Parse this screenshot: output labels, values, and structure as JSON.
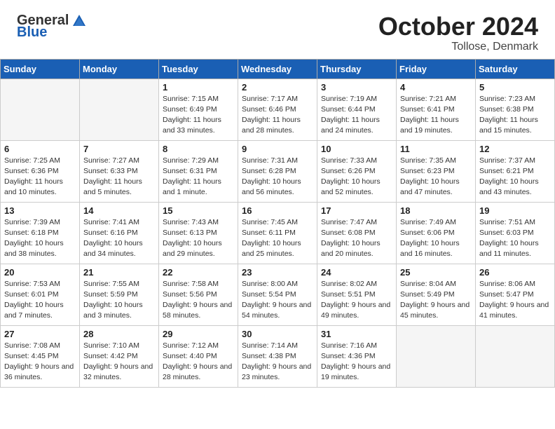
{
  "header": {
    "logo_general": "General",
    "logo_blue": "Blue",
    "title": "October 2024",
    "location": "Tollose, Denmark"
  },
  "days_of_week": [
    "Sunday",
    "Monday",
    "Tuesday",
    "Wednesday",
    "Thursday",
    "Friday",
    "Saturday"
  ],
  "weeks": [
    [
      {
        "day": "",
        "info": ""
      },
      {
        "day": "",
        "info": ""
      },
      {
        "day": "1",
        "info": "Sunrise: 7:15 AM\nSunset: 6:49 PM\nDaylight: 11 hours and 33 minutes."
      },
      {
        "day": "2",
        "info": "Sunrise: 7:17 AM\nSunset: 6:46 PM\nDaylight: 11 hours and 28 minutes."
      },
      {
        "day": "3",
        "info": "Sunrise: 7:19 AM\nSunset: 6:44 PM\nDaylight: 11 hours and 24 minutes."
      },
      {
        "day": "4",
        "info": "Sunrise: 7:21 AM\nSunset: 6:41 PM\nDaylight: 11 hours and 19 minutes."
      },
      {
        "day": "5",
        "info": "Sunrise: 7:23 AM\nSunset: 6:38 PM\nDaylight: 11 hours and 15 minutes."
      }
    ],
    [
      {
        "day": "6",
        "info": "Sunrise: 7:25 AM\nSunset: 6:36 PM\nDaylight: 11 hours and 10 minutes."
      },
      {
        "day": "7",
        "info": "Sunrise: 7:27 AM\nSunset: 6:33 PM\nDaylight: 11 hours and 5 minutes."
      },
      {
        "day": "8",
        "info": "Sunrise: 7:29 AM\nSunset: 6:31 PM\nDaylight: 11 hours and 1 minute."
      },
      {
        "day": "9",
        "info": "Sunrise: 7:31 AM\nSunset: 6:28 PM\nDaylight: 10 hours and 56 minutes."
      },
      {
        "day": "10",
        "info": "Sunrise: 7:33 AM\nSunset: 6:26 PM\nDaylight: 10 hours and 52 minutes."
      },
      {
        "day": "11",
        "info": "Sunrise: 7:35 AM\nSunset: 6:23 PM\nDaylight: 10 hours and 47 minutes."
      },
      {
        "day": "12",
        "info": "Sunrise: 7:37 AM\nSunset: 6:21 PM\nDaylight: 10 hours and 43 minutes."
      }
    ],
    [
      {
        "day": "13",
        "info": "Sunrise: 7:39 AM\nSunset: 6:18 PM\nDaylight: 10 hours and 38 minutes."
      },
      {
        "day": "14",
        "info": "Sunrise: 7:41 AM\nSunset: 6:16 PM\nDaylight: 10 hours and 34 minutes."
      },
      {
        "day": "15",
        "info": "Sunrise: 7:43 AM\nSunset: 6:13 PM\nDaylight: 10 hours and 29 minutes."
      },
      {
        "day": "16",
        "info": "Sunrise: 7:45 AM\nSunset: 6:11 PM\nDaylight: 10 hours and 25 minutes."
      },
      {
        "day": "17",
        "info": "Sunrise: 7:47 AM\nSunset: 6:08 PM\nDaylight: 10 hours and 20 minutes."
      },
      {
        "day": "18",
        "info": "Sunrise: 7:49 AM\nSunset: 6:06 PM\nDaylight: 10 hours and 16 minutes."
      },
      {
        "day": "19",
        "info": "Sunrise: 7:51 AM\nSunset: 6:03 PM\nDaylight: 10 hours and 11 minutes."
      }
    ],
    [
      {
        "day": "20",
        "info": "Sunrise: 7:53 AM\nSunset: 6:01 PM\nDaylight: 10 hours and 7 minutes."
      },
      {
        "day": "21",
        "info": "Sunrise: 7:55 AM\nSunset: 5:59 PM\nDaylight: 10 hours and 3 minutes."
      },
      {
        "day": "22",
        "info": "Sunrise: 7:58 AM\nSunset: 5:56 PM\nDaylight: 9 hours and 58 minutes."
      },
      {
        "day": "23",
        "info": "Sunrise: 8:00 AM\nSunset: 5:54 PM\nDaylight: 9 hours and 54 minutes."
      },
      {
        "day": "24",
        "info": "Sunrise: 8:02 AM\nSunset: 5:51 PM\nDaylight: 9 hours and 49 minutes."
      },
      {
        "day": "25",
        "info": "Sunrise: 8:04 AM\nSunset: 5:49 PM\nDaylight: 9 hours and 45 minutes."
      },
      {
        "day": "26",
        "info": "Sunrise: 8:06 AM\nSunset: 5:47 PM\nDaylight: 9 hours and 41 minutes."
      }
    ],
    [
      {
        "day": "27",
        "info": "Sunrise: 7:08 AM\nSunset: 4:45 PM\nDaylight: 9 hours and 36 minutes."
      },
      {
        "day": "28",
        "info": "Sunrise: 7:10 AM\nSunset: 4:42 PM\nDaylight: 9 hours and 32 minutes."
      },
      {
        "day": "29",
        "info": "Sunrise: 7:12 AM\nSunset: 4:40 PM\nDaylight: 9 hours and 28 minutes."
      },
      {
        "day": "30",
        "info": "Sunrise: 7:14 AM\nSunset: 4:38 PM\nDaylight: 9 hours and 23 minutes."
      },
      {
        "day": "31",
        "info": "Sunrise: 7:16 AM\nSunset: 4:36 PM\nDaylight: 9 hours and 19 minutes."
      },
      {
        "day": "",
        "info": ""
      },
      {
        "day": "",
        "info": ""
      }
    ]
  ]
}
